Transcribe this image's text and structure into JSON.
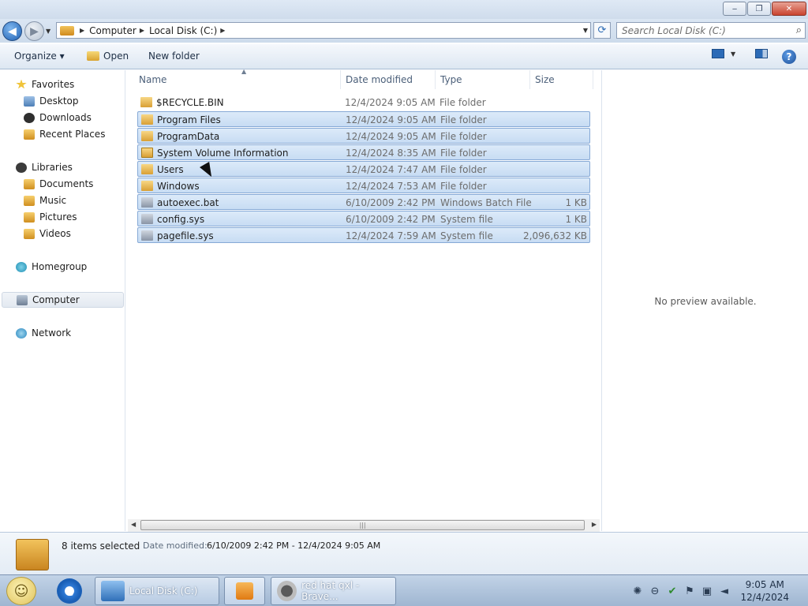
{
  "window": {
    "minimize_glyph": "‒",
    "maximize_glyph": "❐",
    "close_glyph": "✕"
  },
  "address": {
    "crumbs": [
      "Computer",
      "Local Disk (C:)"
    ],
    "search_placeholder": "Search Local Disk (C:)"
  },
  "toolbar": {
    "organize_label": "Organize ▾",
    "open_label": "Open",
    "new_folder_label": "New folder"
  },
  "nav": {
    "favorites": "Favorites",
    "favorites_items": [
      "Desktop",
      "Downloads",
      "Recent Places"
    ],
    "libraries": "Libraries",
    "libraries_items": [
      "Documents",
      "Music",
      "Pictures",
      "Videos"
    ],
    "homegroup": "Homegroup",
    "computer": "Computer",
    "network": "Network"
  },
  "columns": [
    "Name",
    "Date modified",
    "Type",
    "Size"
  ],
  "files": [
    {
      "name": "$RECYCLE.BIN",
      "date": "12/4/2024 9:05 AM",
      "type": "File folder",
      "size": "",
      "icon": "folder-icon",
      "selected": false
    },
    {
      "name": "Program Files",
      "date": "12/4/2024 9:05 AM",
      "type": "File folder",
      "size": "",
      "icon": "folder-icon",
      "selected": true
    },
    {
      "name": "ProgramData",
      "date": "12/4/2024 9:05 AM",
      "type": "File folder",
      "size": "",
      "icon": "folder-icon",
      "selected": true
    },
    {
      "name": "System Volume Information",
      "date": "12/4/2024 8:35 AM",
      "type": "File folder",
      "size": "",
      "icon": "locked-folder-icon",
      "selected": true
    },
    {
      "name": "Users",
      "date": "12/4/2024 7:47 AM",
      "type": "File folder",
      "size": "",
      "icon": "folder-icon",
      "selected": true
    },
    {
      "name": "Windows",
      "date": "12/4/2024 7:53 AM",
      "type": "File folder",
      "size": "",
      "icon": "folder-icon",
      "selected": true
    },
    {
      "name": "autoexec.bat",
      "date": "6/10/2009 2:42 PM",
      "type": "Windows Batch File",
      "size": "1 KB",
      "icon": "batch-file-icon",
      "selected": true
    },
    {
      "name": "config.sys",
      "date": "6/10/2009 2:42 PM",
      "type": "System file",
      "size": "1 KB",
      "icon": "system-file-icon",
      "selected": true
    },
    {
      "name": "pagefile.sys",
      "date": "12/4/2024 7:59 AM",
      "type": "System file",
      "size": "2,096,632 KB",
      "icon": "system-file-icon",
      "selected": true
    }
  ],
  "preview": {
    "text": "No preview available."
  },
  "details": {
    "count": "8 items selected",
    "date_label": "Date modified:",
    "date_value": "6/10/2009 2:42 PM - 12/4/2024 9:05 AM"
  },
  "taskbar": {
    "tasks": [
      "Local Disk (C:)",
      "red hat qxl - Brave..."
    ],
    "time": "9:05 AM",
    "date": "12/4/2024"
  }
}
